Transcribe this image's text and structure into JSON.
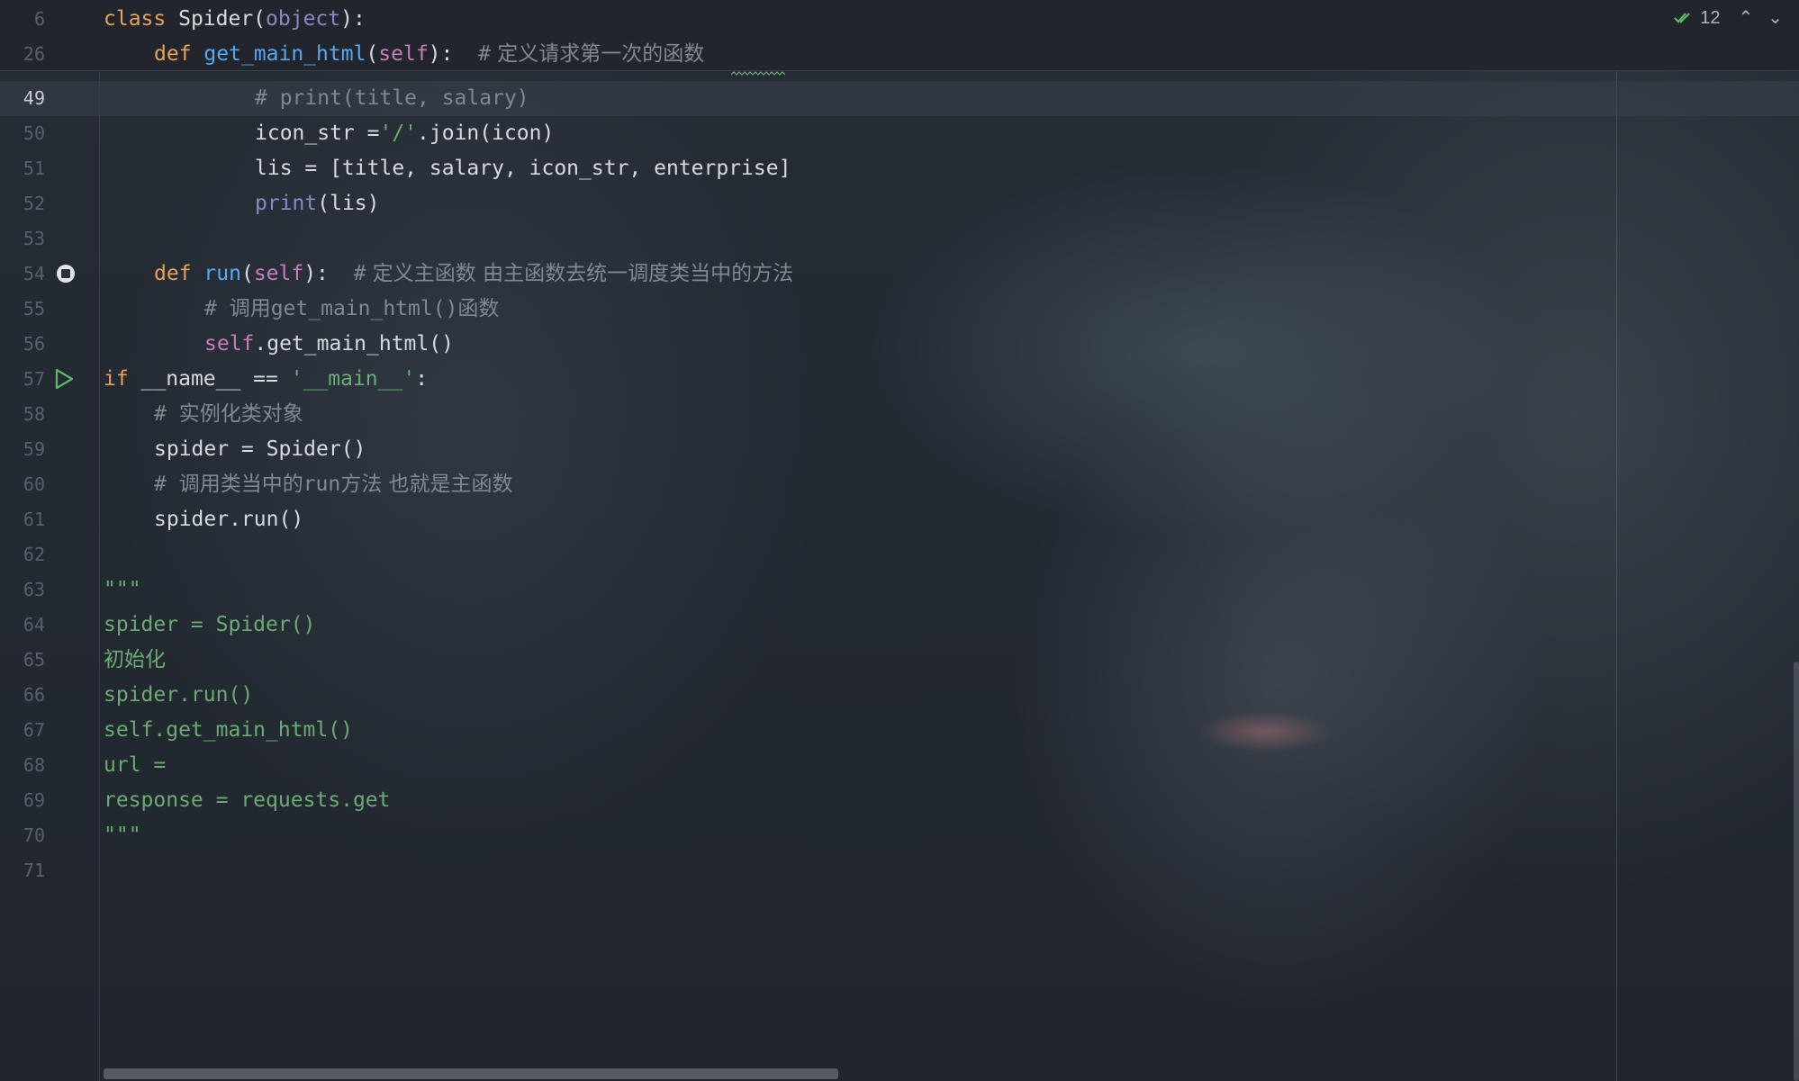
{
  "sticky": [
    {
      "num": "6",
      "code": "class Spider(object):"
    },
    {
      "num": "26",
      "code": "def get_main_html(self):  # 定义请求第一次的函数"
    }
  ],
  "lines": [
    {
      "num": "49",
      "code": "# print(title, salary)"
    },
    {
      "num": "50",
      "code": "icon_str ='/'.join(icon)"
    },
    {
      "num": "51",
      "code": "lis = [title, salary, icon_str, enterprise]"
    },
    {
      "num": "52",
      "code": "print(lis)"
    },
    {
      "num": "53",
      "code": ""
    },
    {
      "num": "54",
      "code": "def run(self):  # 定义主函数 由主函数去统一调度类当中的方法"
    },
    {
      "num": "55",
      "code": "# 调用get_main_html()函数"
    },
    {
      "num": "56",
      "code": "self.get_main_html()"
    },
    {
      "num": "57",
      "code": "if __name__ == '__main__':"
    },
    {
      "num": "58",
      "code": "# 实例化类对象"
    },
    {
      "num": "59",
      "code": "spider = Spider()"
    },
    {
      "num": "60",
      "code": "# 调用类当中的run方法 也就是主函数"
    },
    {
      "num": "61",
      "code": "spider.run()"
    },
    {
      "num": "62",
      "code": ""
    },
    {
      "num": "63",
      "code": "\"\"\""
    },
    {
      "num": "64",
      "code": "spider = Spider()"
    },
    {
      "num": "65",
      "code": "初始化"
    },
    {
      "num": "66",
      "code": "spider.run()"
    },
    {
      "num": "67",
      "code": "self.get_main_html()"
    },
    {
      "num": "68",
      "code": "url ="
    },
    {
      "num": "69",
      "code": "response = requests.get"
    },
    {
      "num": "70",
      "code": "\"\"\""
    },
    {
      "num": "71",
      "code": ""
    }
  ],
  "inspection": {
    "count": "12",
    "ok_icon": "check-double-icon"
  },
  "colors": {
    "keyword": "#e6a15c",
    "function": "#56a8f5",
    "self": "#c77dbb",
    "builtin": "#8888c6",
    "comment": "#808890",
    "string": "#6aab73",
    "text": "#d7dae0",
    "run_icon": "#5fb865"
  }
}
